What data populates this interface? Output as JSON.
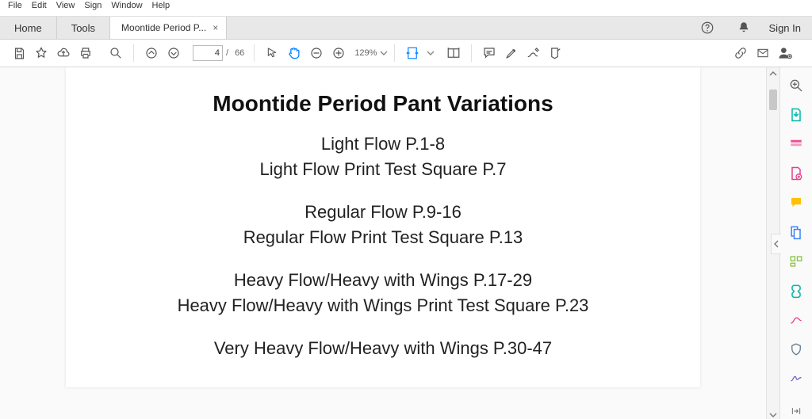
{
  "menu": {
    "items": [
      "File",
      "Edit",
      "View",
      "Sign",
      "Window",
      "Help"
    ]
  },
  "tabs": {
    "home": "Home",
    "tools": "Tools",
    "doc": "Moontide Period P...",
    "signin": "Sign In"
  },
  "toolbar": {
    "page_current": "4",
    "page_sep": "/",
    "page_total": "66",
    "zoom": "129%"
  },
  "doc": {
    "title": "Moontide Period Pant Variations",
    "l1": "Light Flow P.1-8",
    "l2": "Light Flow Print Test Square P.7",
    "l3": "Regular Flow P.9-16",
    "l4": "Regular Flow Print Test Square P.13",
    "l5": "Heavy Flow/Heavy with Wings P.17-29",
    "l6": "Heavy Flow/Heavy with Wings Print Test Square P.23",
    "l7": "Very Heavy Flow/Heavy with Wings P.30-47"
  },
  "colors": {
    "exportpdf": "#00b8a9",
    "edit": "#e83e8c",
    "createpdf": "#e83e8c",
    "comment": "#ffc107",
    "combine": "#3b82f6",
    "organize": "#8bc34a",
    "compress": "#00b8a9",
    "redact": "#e83e8c",
    "protect": "#6a7b8c",
    "sign": "#7b5ccf"
  }
}
